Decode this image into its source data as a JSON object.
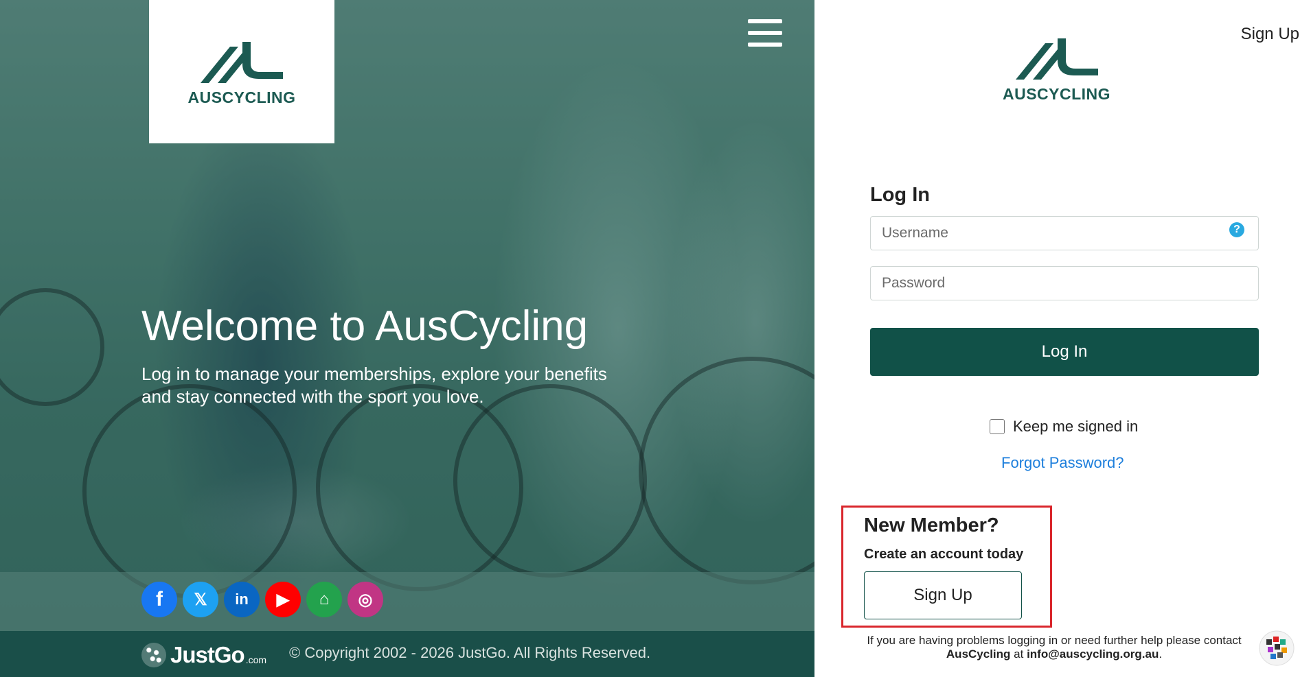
{
  "brand": {
    "name": "AUSCYCLING",
    "primary_color": "#115148",
    "accent_color": "#1c5a52"
  },
  "hero": {
    "title": "Welcome to AusCycling",
    "subtitle": "Log in to manage your memberships, explore your benefits and stay connected with the sport you love.",
    "menu_icon": "hamburger-menu-icon"
  },
  "socials": [
    {
      "name": "facebook",
      "glyph": "f"
    },
    {
      "name": "x-twitter",
      "glyph": "𝕏"
    },
    {
      "name": "linkedin",
      "glyph": "in"
    },
    {
      "name": "youtube",
      "glyph": "▶"
    },
    {
      "name": "home",
      "glyph": "⌂"
    },
    {
      "name": "instagram",
      "glyph": "◎"
    }
  ],
  "footer": {
    "justgo_word": "JustGo",
    "justgo_suffix": ".com",
    "copyright": "© Copyright 2002 - 2026 JustGo. All Rights Reserved."
  },
  "panel": {
    "top_signup": "Sign Up",
    "login_title": "Log In",
    "username_placeholder": "Username",
    "password_placeholder": "Password",
    "help_glyph": "?",
    "login_button": "Log In",
    "keep_signed_in": "Keep me signed in",
    "forgot_password": "Forgot Password?",
    "new_member_title": "New Member?",
    "new_member_sub": "Create an account today",
    "signup_button": "Sign Up",
    "help_prefix": "If you are having problems logging in or need further help please contact ",
    "help_org": "AusCycling",
    "help_at": " at ",
    "help_email": "info@auscycling.org.au",
    "help_end": "."
  }
}
